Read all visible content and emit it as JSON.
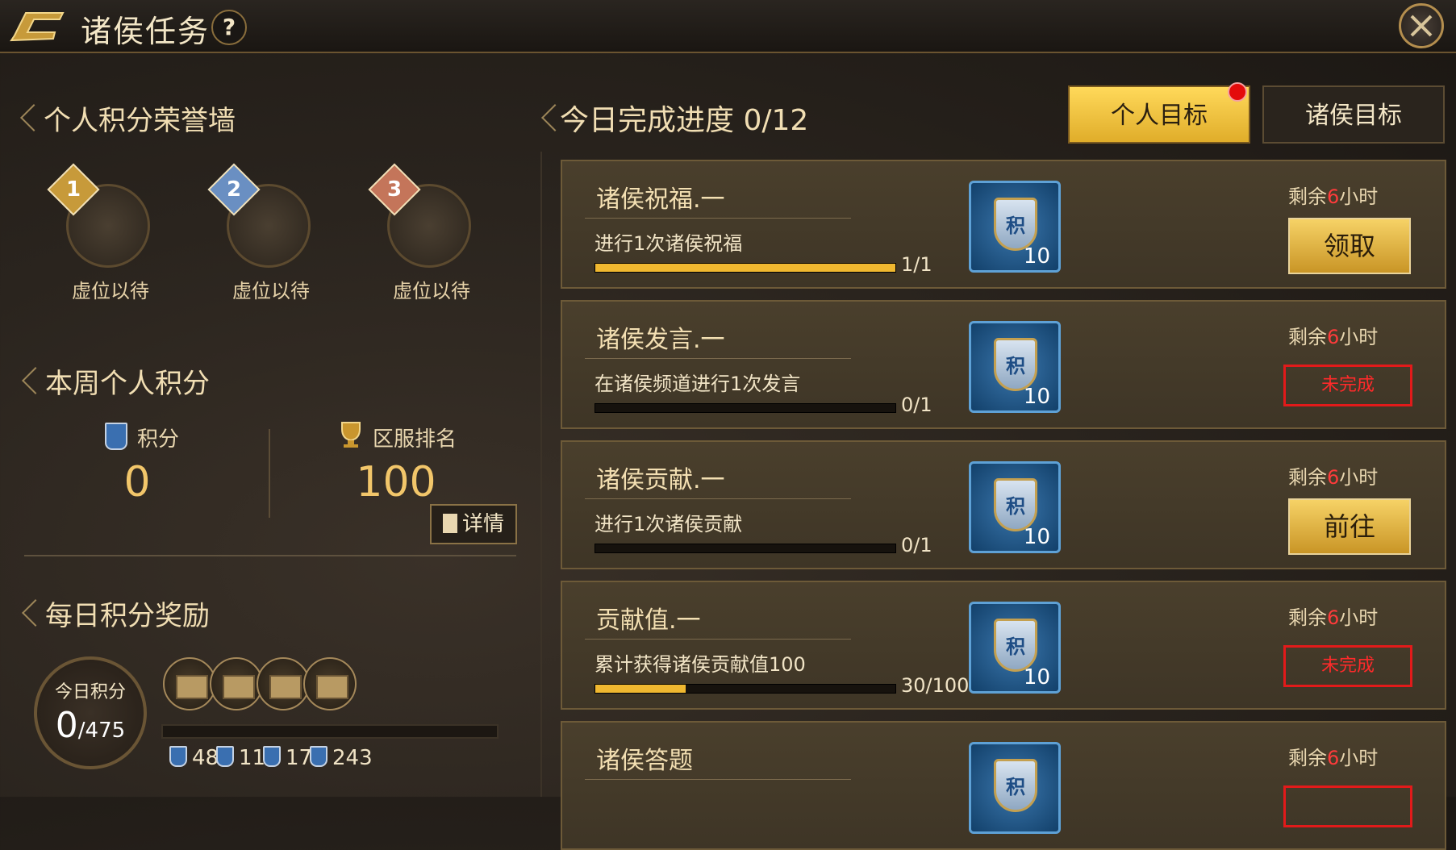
{
  "header": {
    "title": "诸侯任务",
    "help": "?"
  },
  "honor_wall": {
    "title": "个人积分荣誉墙",
    "slots": [
      {
        "rank": "1",
        "label": "虚位以待",
        "badge_color": "#c79a3a"
      },
      {
        "rank": "2",
        "label": "虚位以待",
        "badge_color": "#6a8fc2"
      },
      {
        "rank": "3",
        "label": "虚位以待",
        "badge_color": "#c4755a"
      }
    ]
  },
  "weekly": {
    "title": "本周个人积分",
    "points_label": "积分",
    "points_value": "0",
    "rank_label": "区服排名",
    "rank_value": "100",
    "details_label": "详情"
  },
  "daily": {
    "title": "每日积分奖励",
    "today_label": "今日积分",
    "today_value": "0",
    "today_max": "/475",
    "progress": 0,
    "milestones": [
      "48",
      "113",
      "178",
      "243"
    ]
  },
  "progress": {
    "title": "今日完成进度 0/12"
  },
  "tabs": {
    "personal": "个人目标",
    "lords": "诸侯目标"
  },
  "tasks": [
    {
      "name": "诸侯祝福.一",
      "desc": "进行1次诸侯祝福",
      "progress_text": "1/1",
      "progress": 1.0,
      "reward_char": "积",
      "reward": "10",
      "remain_pre": "剩余",
      "remain_num": "6",
      "remain_post": "小时",
      "action": "领取",
      "action_type": "gold"
    },
    {
      "name": "诸侯发言.一",
      "desc": "在诸侯频道进行1次发言",
      "progress_text": "0/1",
      "progress": 0.0,
      "reward_char": "积",
      "reward": "10",
      "remain_pre": "剩余",
      "remain_num": "6",
      "remain_post": "小时",
      "action": "未完成",
      "action_type": "red"
    },
    {
      "name": "诸侯贡献.一",
      "desc": "进行1次诸侯贡献",
      "progress_text": "0/1",
      "progress": 0.0,
      "reward_char": "积",
      "reward": "10",
      "remain_pre": "剩余",
      "remain_num": "6",
      "remain_post": "小时",
      "action": "前往",
      "action_type": "gold"
    },
    {
      "name": "贡献值.一",
      "desc": "累计获得诸侯贡献值100",
      "progress_text": "30/100",
      "progress": 0.3,
      "reward_char": "积",
      "reward": "10",
      "remain_pre": "剩余",
      "remain_num": "6",
      "remain_post": "小时",
      "action": "未完成",
      "action_type": "red"
    },
    {
      "name": "诸侯答题",
      "desc": "",
      "progress_text": "",
      "progress": 0.0,
      "reward_char": "积",
      "reward": "",
      "remain_pre": "剩余",
      "remain_num": "6",
      "remain_post": "小时",
      "action": "",
      "action_type": "red"
    }
  ]
}
